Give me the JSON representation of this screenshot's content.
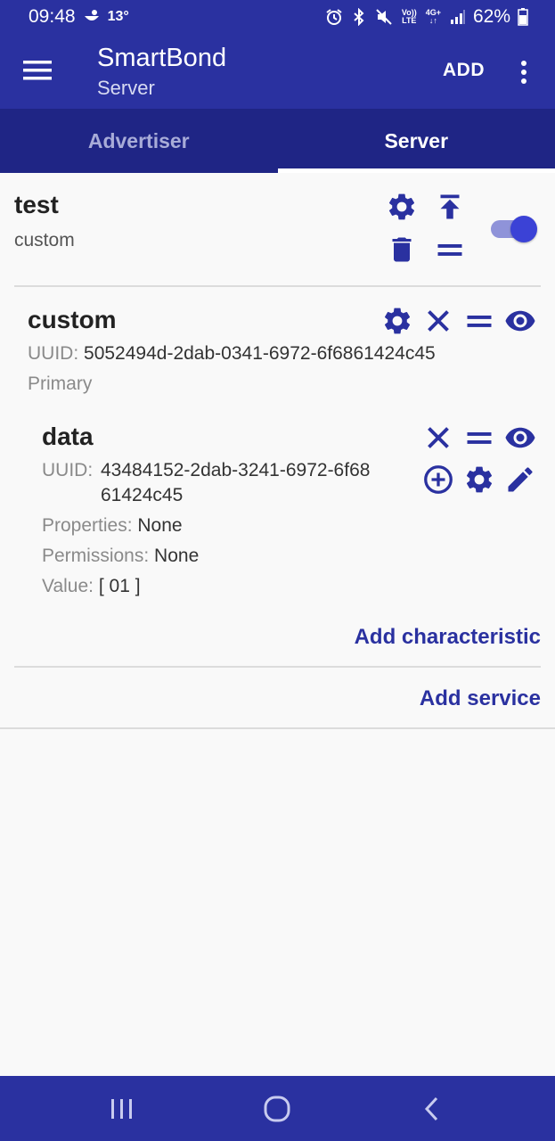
{
  "status_bar": {
    "time": "09:48",
    "temperature": "13°",
    "volte_top": "Vo))",
    "volte_bottom": "LTE",
    "network_top": "4G+",
    "network_bottom": "↓↑",
    "battery": "62%",
    "icons": [
      "weather-icon",
      "alarm-icon",
      "bluetooth-icon",
      "mute-icon",
      "signal-icon",
      "battery-icon"
    ]
  },
  "app_bar": {
    "title": "SmartBond",
    "subtitle": "Server",
    "add_label": "ADD"
  },
  "tabs": [
    {
      "label": "Advertiser",
      "active": false
    },
    {
      "label": "Server",
      "active": true
    }
  ],
  "server": {
    "name": "test",
    "type": "custom",
    "enabled": true,
    "icons": [
      "gear-icon",
      "upload-icon",
      "delete-icon",
      "reorder-icon"
    ]
  },
  "service": {
    "name": "custom",
    "uuid_label": "UUID:",
    "uuid": "5052494d-2dab-0341-6972-6f6861424c45",
    "kind": "Primary",
    "icons": [
      "gear-icon",
      "close-icon",
      "reorder-icon",
      "eye-icon"
    ]
  },
  "characteristic": {
    "name": "data",
    "uuid_label": "UUID:",
    "uuid_line1": "43484152-2dab-3241-6972-6f68",
    "uuid_line2": "61424c45",
    "properties_label": "Properties:",
    "properties": "None",
    "permissions_label": "Permissions:",
    "permissions": "None",
    "value_label": "Value:",
    "value": "[ 01 ]",
    "icons": [
      "close-icon",
      "reorder-icon",
      "eye-icon",
      "add-circle-icon",
      "gear-icon",
      "edit-icon"
    ]
  },
  "actions": {
    "add_characteristic": "Add characteristic",
    "add_service": "Add service"
  },
  "colors": {
    "primary": "#2a31a0",
    "primary_dark": "#1f2585",
    "accent": "#3b42d6"
  }
}
